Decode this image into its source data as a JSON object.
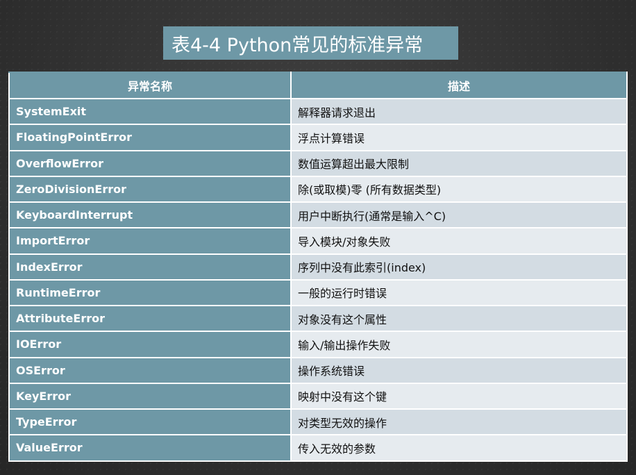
{
  "title": "表4-4 Python常见的标准异常",
  "table": {
    "headers": [
      "异常名称",
      "描述"
    ],
    "rows": [
      {
        "name": "SystemExit",
        "desc": "解释器请求退出"
      },
      {
        "name": "FloatingPointError",
        "desc": "浮点计算错误"
      },
      {
        "name": "OverflowError",
        "desc": "数值运算超出最大限制"
      },
      {
        "name": "ZeroDivisionError",
        "desc": "除(或取模)零 (所有数据类型)"
      },
      {
        "name": "KeyboardInterrupt",
        "desc": "用户中断执行(通常是输入^C)"
      },
      {
        "name": "ImportError",
        "desc": "导入模块/对象失败"
      },
      {
        "name": "IndexError",
        "desc": "序列中没有此索引(index)"
      },
      {
        "name": "RuntimeError",
        "desc": "一般的运行时错误"
      },
      {
        "name": "AttributeError",
        "desc": "对象没有这个属性"
      },
      {
        "name": "IOError",
        "desc": "输入/输出操作失败"
      },
      {
        "name": "OSError",
        "desc": "操作系统错误"
      },
      {
        "name": "KeyError",
        "desc": "映射中没有这个键"
      },
      {
        "name": "TypeError",
        "desc": "对类型无效的操作"
      },
      {
        "name": "ValueError",
        "desc": "传入无效的参数"
      }
    ]
  }
}
